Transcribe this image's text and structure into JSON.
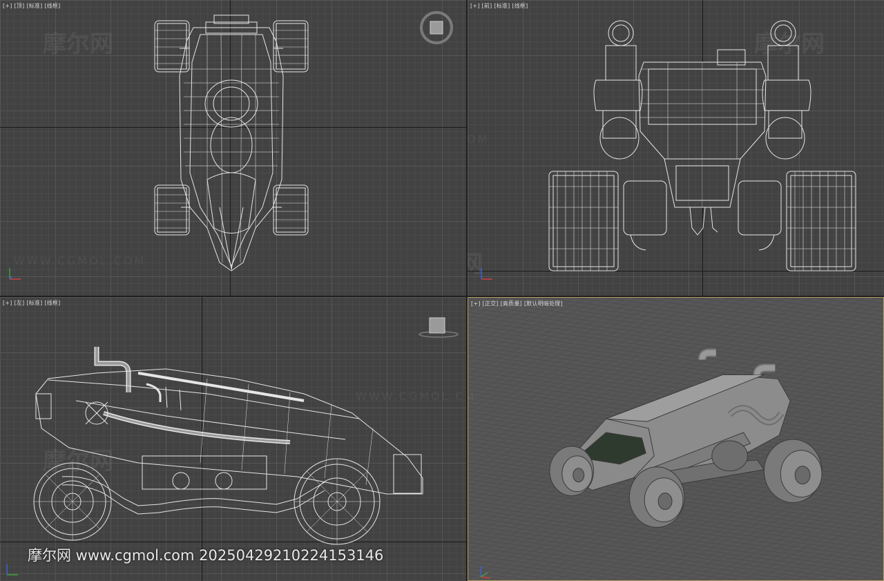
{
  "viewports": {
    "top": {
      "labels": [
        "[+]",
        "[顶]",
        "[标准]",
        "[线框]"
      ]
    },
    "front": {
      "labels": [
        "[+]",
        "[前]",
        "[标准]",
        "[线框]"
      ]
    },
    "left": {
      "labels": [
        "[+]",
        "[左]",
        "[标准]",
        "[线框]"
      ]
    },
    "perspective": {
      "labels": [
        "[+]",
        "[正交]",
        "[高质量]",
        "[默认明暗处理]"
      ]
    }
  },
  "watermark": {
    "logo": "摩尔网",
    "url": "WWW.CGMOL.COM",
    "caption": "摩尔网 www.cgmol.com 20250429210224153146"
  },
  "colors": {
    "viewport_bg": "#424242",
    "grid_major": "#565656",
    "wireframe": "#e6e6e6",
    "active_border": "#b8a063",
    "shaded_model": "#8a8a8a",
    "windshield": "#2e3a2e"
  },
  "icons": {
    "viewcube": "viewcube-icon",
    "axis": "axis-tripod-icon"
  }
}
